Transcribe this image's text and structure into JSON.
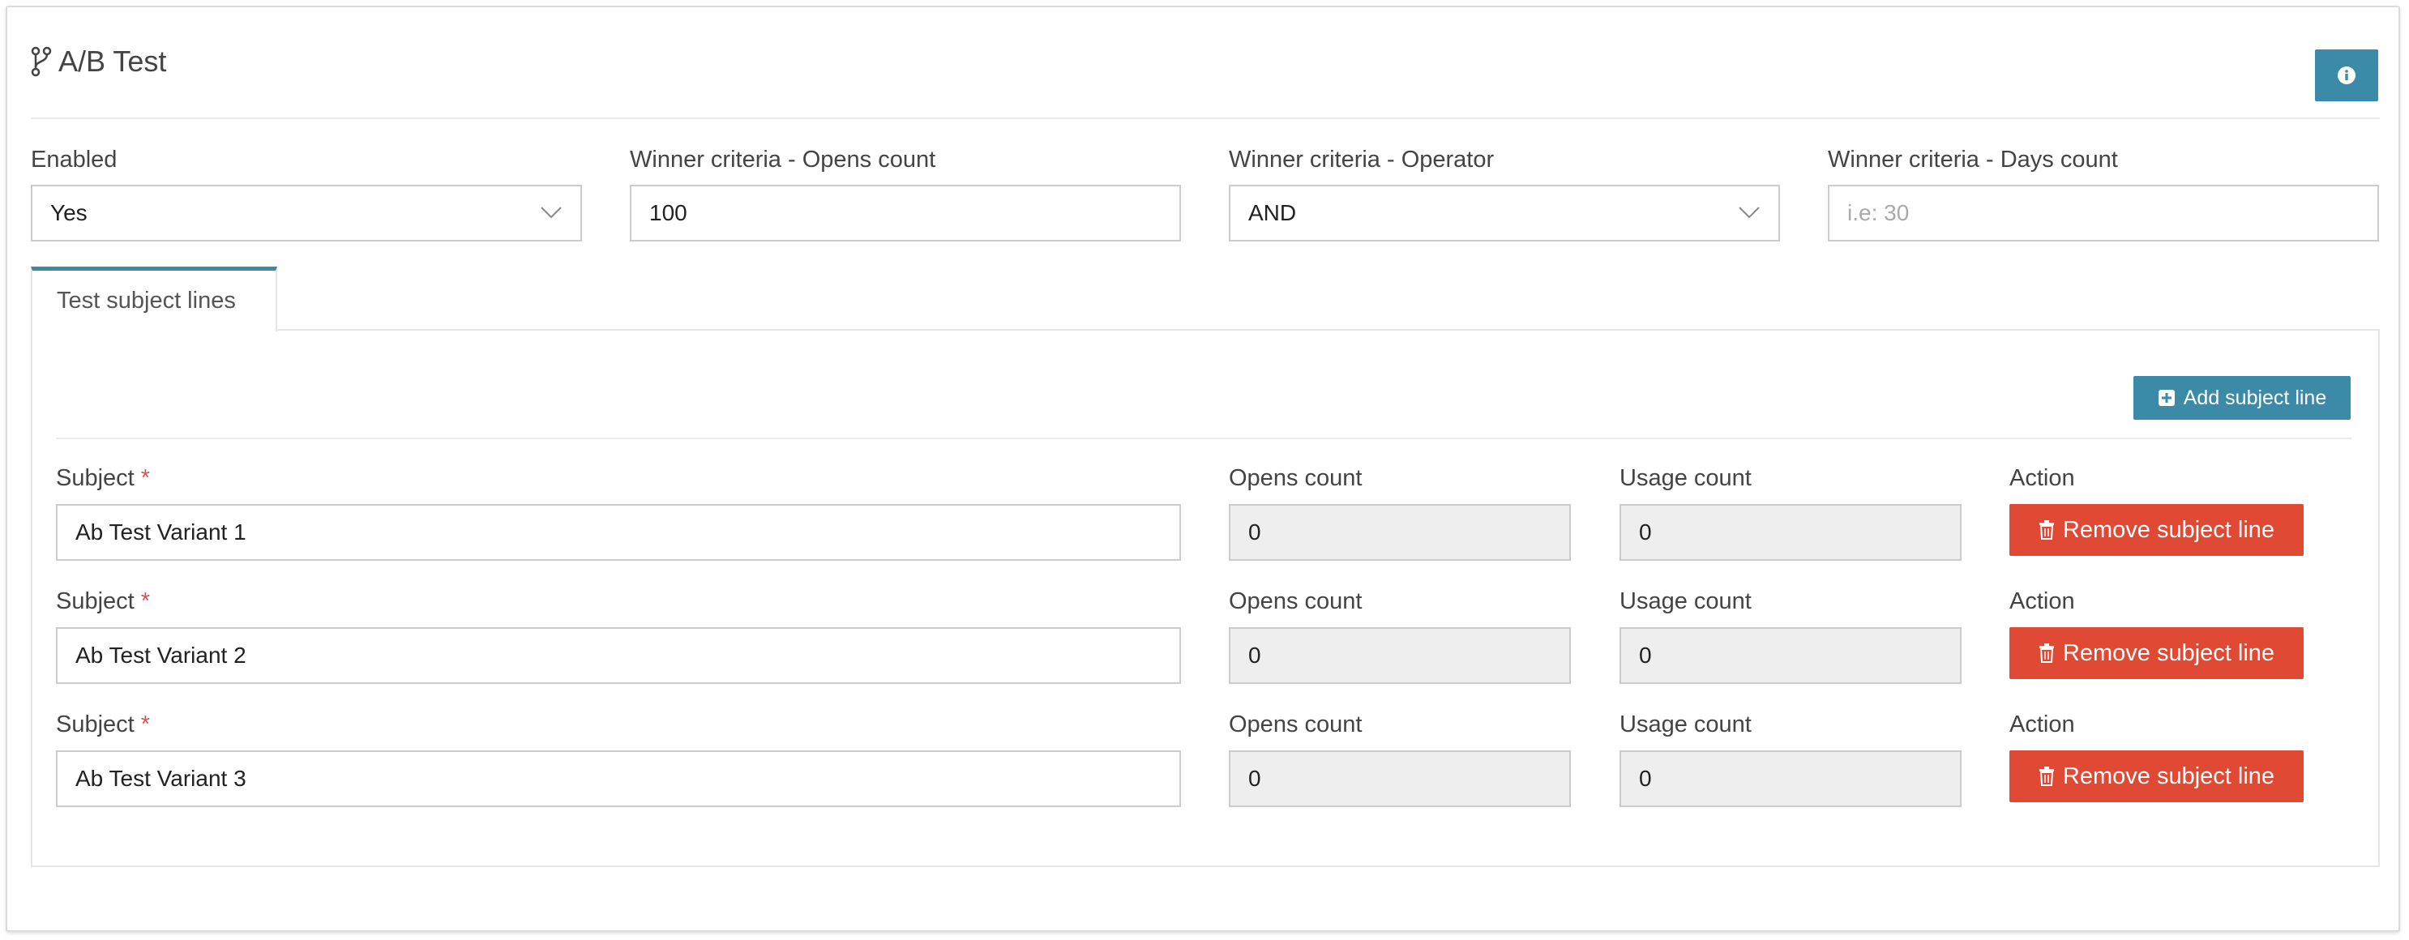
{
  "header": {
    "title": "A/B Test",
    "icon": "code-branch-icon",
    "info_icon": "info-icon"
  },
  "settings": {
    "enabled": {
      "label": "Enabled",
      "value": "Yes"
    },
    "opens_count": {
      "label": "Winner criteria - Opens count",
      "value": "100"
    },
    "operator": {
      "label": "Winner criteria - Operator",
      "value": "AND"
    },
    "days_count": {
      "label": "Winner criteria - Days count",
      "value": "",
      "placeholder": "i.e: 30"
    }
  },
  "tabs": [
    {
      "label": "Test subject lines",
      "active": true
    }
  ],
  "add_button": {
    "label": "Add subject line",
    "icon": "plus-square-icon"
  },
  "subject_lines": [
    {
      "subject_label": "Subject",
      "required_mark": "*",
      "subject": "Ab Test Variant 1",
      "opens_label": "Opens count",
      "opens": "0",
      "usage_label": "Usage count",
      "usage": "0",
      "action_label": "Action",
      "remove_label": "Remove subject line"
    },
    {
      "subject_label": "Subject",
      "required_mark": "*",
      "subject": "Ab Test Variant 2",
      "opens_label": "Opens count",
      "opens": "0",
      "usage_label": "Usage count",
      "usage": "0",
      "action_label": "Action",
      "remove_label": "Remove subject line"
    },
    {
      "subject_label": "Subject",
      "required_mark": "*",
      "subject": "Ab Test Variant 3",
      "opens_label": "Opens count",
      "opens": "0",
      "usage_label": "Usage count",
      "usage": "0",
      "action_label": "Action",
      "remove_label": "Remove subject line"
    }
  ],
  "colors": {
    "primary": "#3a8aa8",
    "danger": "#e04a35",
    "required": "#d9534f"
  }
}
